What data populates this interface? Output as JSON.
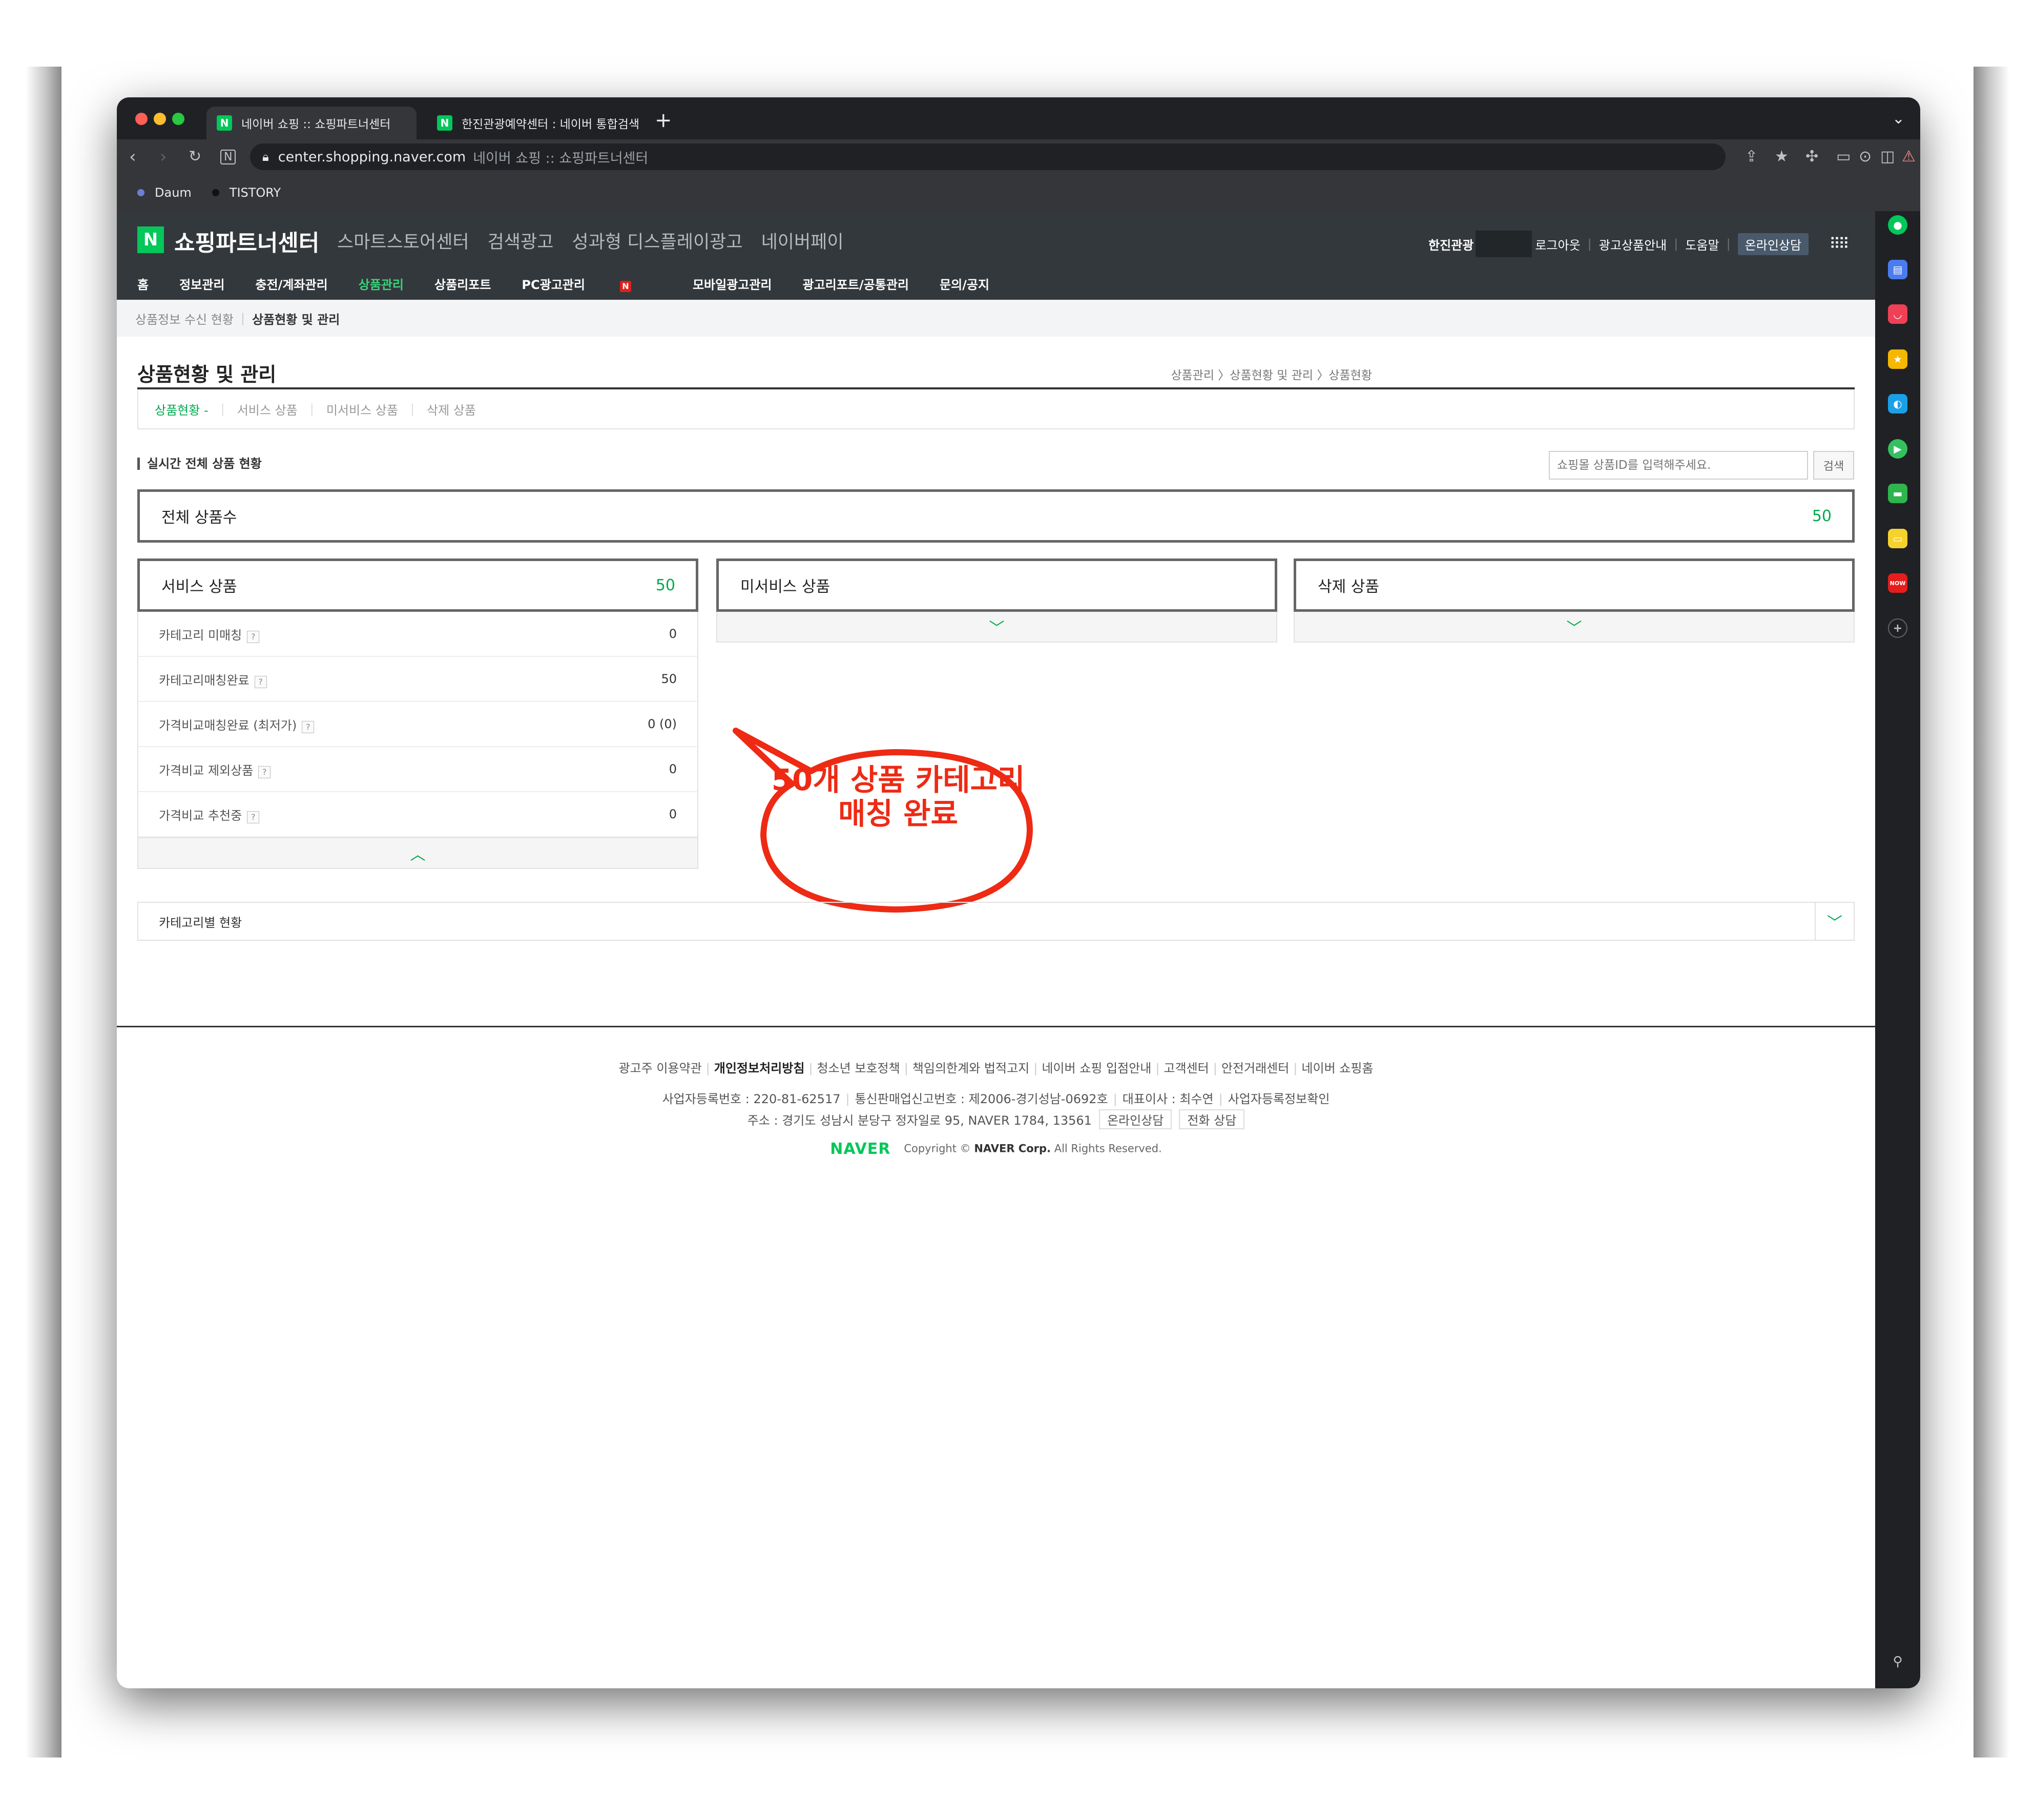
{
  "browser": {
    "tabs": [
      {
        "title": "네이버 쇼핑 :: 쇼핑파트너센터",
        "favicon": "N"
      },
      {
        "title": "한진관광예약센터 : 네이버 통합검색",
        "favicon": "N"
      }
    ],
    "new_tab": "+",
    "address": {
      "host": "center.shopping.naver.com",
      "page_title": "네이버 쇼핑 :: 쇼핑파트너센터"
    },
    "bookmarks": [
      {
        "label": "Daum",
        "dot_color": "#6a7fd8"
      },
      {
        "label": "TISTORY",
        "dot_color": "#111111"
      }
    ]
  },
  "header": {
    "logo_mark": "N",
    "logo_text": "쇼핑파트너센터",
    "top_menu": [
      "스마트스토어센터",
      "검색광고",
      "성과형 디스플레이광고",
      "네이버페이"
    ],
    "user_name": "한진관광",
    "util_links": [
      "로그아웃",
      "광고상품안내",
      "도움말"
    ],
    "consult": "온라인상담",
    "nav": [
      "홈",
      "정보관리",
      "충전/계좌관리",
      "상품관리",
      "상품리포트",
      "PC광고관리",
      "모바일광고관리",
      "광고리포트/공통관리",
      "문의/공지"
    ],
    "nav_badge": "N",
    "nav_active": "상품관리"
  },
  "location": {
    "prev": "상품정보 수신 현황",
    "current": "상품현황 및 관리"
  },
  "page": {
    "title": "상품현황 및 관리",
    "path": "상품관리 〉상품현황 및 관리 〉상품현황",
    "tabs": [
      "상품현황 -",
      "서비스 상품",
      "미서비스 상품",
      "삭제 상품"
    ],
    "section_title": "실시간 전체 상품 현황",
    "search_placeholder": "쇼핑몰 상품ID를 입력해주세요.",
    "search_button": "검색",
    "total": {
      "label": "전체 상품수",
      "value": "50"
    },
    "service": {
      "label": "서비스 상품",
      "value": "50",
      "rows": [
        {
          "label": "카테고리 미매칭",
          "value": "0"
        },
        {
          "label": "카테고리매칭완료",
          "value": "50"
        },
        {
          "label": "가격비교매칭완료 (최저가)",
          "value": "0 (0)"
        },
        {
          "label": "가격비교 제외상품",
          "value": "0"
        },
        {
          "label": "가격비교 추천중",
          "value": "0"
        }
      ]
    },
    "non_service": {
      "label": "미서비스 상품"
    },
    "deleted": {
      "label": "삭제 상품"
    },
    "callout": {
      "line1": "50개 상품 카테고리",
      "line2": "매칭 완료",
      "color": "#ee2a14"
    },
    "category_status": "카테고리별 현황"
  },
  "footer": {
    "links": [
      "광고주 이용약관",
      "개인정보처리방침",
      "청소년 보호정책",
      "책임의한계와 법적고지",
      "네이버 쇼핑 입점안내",
      "고객센터",
      "안전거래센터",
      "네이버 쇼핑홈"
    ],
    "biz_info": [
      "사업자등록번호 : 220-81-62517",
      "통신판매업신고번호 : 제2006-경기성남-0692호",
      "대표이사 : 최수연",
      "사업자등록정보확인"
    ],
    "address": "주소 : 경기도 성남시 분당구 정자일로 95, NAVER 1784, 13561",
    "buttons": [
      "온라인상담",
      "전화 상담"
    ],
    "brand": "NAVER",
    "copyright_prefix": "Copyright ©",
    "copyright_company": "NAVER Corp.",
    "copyright_suffix": "All Rights Reserved."
  },
  "colors": {
    "accent": "#03c75a",
    "header_bg": "#33383c",
    "callout": "#ee2a14"
  }
}
